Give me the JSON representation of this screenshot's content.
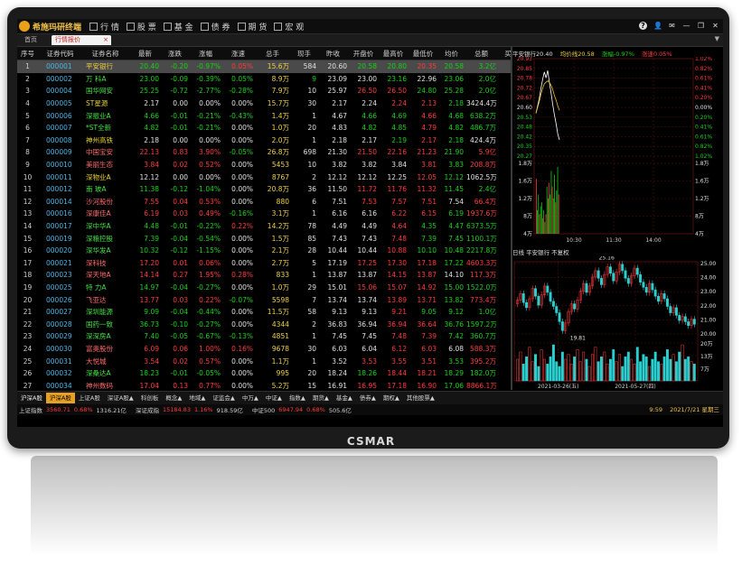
{
  "app": {
    "logo_text": "希施玛研终端",
    "menu": [
      {
        "label": "行 情",
        "icon": "quotes-icon"
      },
      {
        "label": "股 票",
        "icon": "stock-icon"
      },
      {
        "label": "基 金",
        "icon": "fund-icon"
      },
      {
        "label": "债 券",
        "icon": "bond-icon"
      },
      {
        "label": "期 货",
        "icon": "futures-icon"
      },
      {
        "label": "宏 观",
        "icon": "macro-icon"
      }
    ],
    "window_controls": {
      "help": "?",
      "user": "👤",
      "msg": "✉",
      "minimize": "—",
      "restore": "❐",
      "close": "✕"
    }
  },
  "tabs": {
    "home": "首页",
    "active": "行情报价",
    "close": "×",
    "more": "▼"
  },
  "table": {
    "headers": [
      "序号",
      "证券代码",
      "证券名称",
      "最新",
      "涨跌",
      "涨幅",
      "涨速",
      "总手",
      "现手",
      "昨收",
      "开盘价",
      "最高价",
      "最低价",
      "均价",
      "总额",
      "买"
    ],
    "rows": [
      [
        "1",
        "000001",
        "平安银行",
        "20.40",
        "-0.20",
        "-0.97%",
        "0.05%",
        "15.6万",
        "584",
        "20.60",
        "20.58",
        "20.80",
        "20.35",
        "20.58",
        "3.2亿",
        ""
      ],
      [
        "2",
        "000002",
        "万 科A",
        "23.00",
        "-0.09",
        "-0.39%",
        "0.05%",
        "8.9万",
        "9",
        "23.09",
        "23.00",
        "23.16",
        "22.96",
        "23.06",
        "2.0亿",
        ""
      ],
      [
        "3",
        "000004",
        "国华网安",
        "25.25",
        "-0.72",
        "-2.77%",
        "-0.28%",
        "7.9万",
        "10",
        "25.97",
        "26.50",
        "26.50",
        "24.80",
        "25.28",
        "2.0亿",
        ""
      ],
      [
        "4",
        "000005",
        "ST星源",
        "2.17",
        "0.00",
        "0.00%",
        "0.00%",
        "15.7万",
        "30",
        "2.17",
        "2.24",
        "2.24",
        "2.13",
        "2.18",
        "3424.4万",
        ""
      ],
      [
        "5",
        "000006",
        "深振业A",
        "4.66",
        "-0.01",
        "-0.21%",
        "-0.43%",
        "1.4万",
        "1",
        "4.67",
        "4.66",
        "4.69",
        "4.66",
        "4.68",
        "638.2万",
        ""
      ],
      [
        "6",
        "000007",
        "*ST全新",
        "4.82",
        "-0.01",
        "-0.21%",
        "0.00%",
        "1.0万",
        "20",
        "4.83",
        "4.82",
        "4.85",
        "4.79",
        "4.82",
        "486.7万",
        ""
      ],
      [
        "7",
        "000008",
        "神州高铁",
        "2.18",
        "0.00",
        "0.00%",
        "0.00%",
        "2.0万",
        "1",
        "2.18",
        "2.17",
        "2.19",
        "2.17",
        "2.18",
        "424.4万",
        ""
      ],
      [
        "8",
        "000009",
        "中国宝安",
        "22.13",
        "0.83",
        "3.90%",
        "-0.05%",
        "26.8万",
        "698",
        "21.30",
        "21.50",
        "22.16",
        "21.23",
        "21.90",
        "5.9亿",
        ""
      ],
      [
        "9",
        "000010",
        "美丽生态",
        "3.84",
        "0.02",
        "0.52%",
        "0.00%",
        "5453",
        "10",
        "3.82",
        "3.82",
        "3.84",
        "3.81",
        "3.83",
        "208.8万",
        ""
      ],
      [
        "10",
        "000011",
        "深物业A",
        "12.12",
        "0.00",
        "0.00%",
        "0.00%",
        "8767",
        "2",
        "12.12",
        "12.12",
        "12.25",
        "12.05",
        "12.12",
        "1062.5万",
        ""
      ],
      [
        "11",
        "000012",
        "南 玻A",
        "11.38",
        "-0.12",
        "-1.04%",
        "0.00%",
        "20.8万",
        "36",
        "11.50",
        "11.72",
        "11.76",
        "11.32",
        "11.45",
        "2.4亿",
        ""
      ],
      [
        "12",
        "000014",
        "沙河股份",
        "7.55",
        "0.04",
        "0.53%",
        "0.00%",
        "880",
        "6",
        "7.51",
        "7.53",
        "7.57",
        "7.51",
        "7.54",
        "66.4万",
        ""
      ],
      [
        "13",
        "000016",
        "深康佳A",
        "6.19",
        "0.03",
        "0.49%",
        "-0.16%",
        "3.1万",
        "1",
        "6.16",
        "6.16",
        "6.22",
        "6.15",
        "6.19",
        "1937.6万",
        ""
      ],
      [
        "14",
        "000017",
        "深中华A",
        "4.48",
        "-0.01",
        "-0.22%",
        "0.22%",
        "14.2万",
        "78",
        "4.49",
        "4.49",
        "4.64",
        "4.35",
        "4.47",
        "6373.5万",
        ""
      ],
      [
        "15",
        "000019",
        "深粮控股",
        "7.39",
        "-0.04",
        "-0.54%",
        "0.00%",
        "1.5万",
        "85",
        "7.43",
        "7.43",
        "7.48",
        "7.39",
        "7.45",
        "1100.1万",
        ""
      ],
      [
        "16",
        "000020",
        "深华发A",
        "10.32",
        "-0.12",
        "-1.15%",
        "0.00%",
        "2.1万",
        "28",
        "10.44",
        "10.44",
        "10.88",
        "10.10",
        "10.48",
        "2217.8万",
        ""
      ],
      [
        "17",
        "000021",
        "深科技",
        "17.20",
        "0.01",
        "0.06%",
        "0.00%",
        "2.7万",
        "5",
        "17.19",
        "17.25",
        "17.30",
        "17.18",
        "17.22",
        "4603.3万",
        ""
      ],
      [
        "18",
        "000023",
        "深天地A",
        "14.14",
        "0.27",
        "1.95%",
        "0.28%",
        "833",
        "1",
        "13.87",
        "13.87",
        "14.15",
        "13.87",
        "14.10",
        "117.3万",
        ""
      ],
      [
        "19",
        "000025",
        "特 力A",
        "14.97",
        "-0.04",
        "-0.27%",
        "0.00%",
        "1.0万",
        "29",
        "15.01",
        "15.06",
        "15.07",
        "14.92",
        "15.00",
        "1522.0万",
        ""
      ],
      [
        "20",
        "000026",
        "飞亚达",
        "13.77",
        "0.03",
        "0.22%",
        "-0.07%",
        "5598",
        "7",
        "13.74",
        "13.74",
        "13.89",
        "13.71",
        "13.82",
        "773.4万",
        ""
      ],
      [
        "21",
        "000027",
        "深圳能源",
        "9.09",
        "-0.04",
        "-0.44%",
        "0.00%",
        "11.5万",
        "58",
        "9.13",
        "9.13",
        "9.21",
        "9.05",
        "9.12",
        "1.0亿",
        ""
      ],
      [
        "22",
        "000028",
        "国药一致",
        "36.73",
        "-0.10",
        "-0.27%",
        "0.00%",
        "4344",
        "2",
        "36.83",
        "36.94",
        "36.94",
        "36.64",
        "36.76",
        "1597.2万",
        ""
      ],
      [
        "23",
        "000029",
        "深深房A",
        "7.40",
        "-0.05",
        "-0.67%",
        "-0.13%",
        "4851",
        "1",
        "7.45",
        "7.45",
        "7.48",
        "7.39",
        "7.42",
        "360.7万",
        ""
      ],
      [
        "24",
        "000030",
        "富奥股份",
        "6.09",
        "0.06",
        "1.00%",
        "0.16%",
        "9678",
        "30",
        "6.03",
        "6.04",
        "6.12",
        "6.03",
        "6.08",
        "588.3万",
        ""
      ],
      [
        "25",
        "000031",
        "大悦城",
        "3.54",
        "0.02",
        "0.57%",
        "0.00%",
        "1.1万",
        "1",
        "3.52",
        "3.53",
        "3.55",
        "3.51",
        "3.53",
        "395.2万",
        ""
      ],
      [
        "26",
        "000032",
        "深桑达A",
        "18.23",
        "-0.01",
        "-0.05%",
        "0.00%",
        "995",
        "20",
        "18.24",
        "18.26",
        "18.44",
        "18.21",
        "18.29",
        "182.0万",
        ""
      ],
      [
        "27",
        "000034",
        "神州数码",
        "17.04",
        "0.13",
        "0.77%",
        "0.00%",
        "5.2万",
        "15",
        "16.91",
        "16.95",
        "17.18",
        "16.90",
        "17.06",
        "8866.1万",
        ""
      ]
    ],
    "row_colors": [
      [
        "dn",
        "dn",
        "dn",
        "up",
        "yl",
        "fl",
        "fl",
        "dn",
        "dn",
        "up",
        "dn",
        "dn",
        "dn",
        "yl"
      ],
      [
        "dn",
        "dn",
        "dn",
        "dn",
        "yl",
        "dn",
        "fl",
        "fl",
        "dn",
        "fl",
        "dn",
        "dn",
        "dn",
        "yl"
      ],
      [
        "dn",
        "dn",
        "dn",
        "dn",
        "yl",
        "fl",
        "fl",
        "up",
        "up",
        "dn",
        "dn",
        "dn",
        "dn",
        "yl"
      ],
      [
        "fl",
        "fl",
        "fl",
        "fl",
        "yl",
        "fl",
        "fl",
        "fl",
        "up",
        "up",
        "dn",
        "fl",
        "fl",
        "yl"
      ],
      [
        "dn",
        "dn",
        "dn",
        "dn",
        "yl",
        "fl",
        "fl",
        "dn",
        "dn",
        "up",
        "dn",
        "dn",
        "dn",
        "yl"
      ],
      [
        "dn",
        "dn",
        "dn",
        "fl",
        "yl",
        "fl",
        "fl",
        "dn",
        "dn",
        "up",
        "dn",
        "dn",
        "dn",
        "yl"
      ],
      [
        "fl",
        "fl",
        "fl",
        "fl",
        "yl",
        "fl",
        "fl",
        "fl",
        "dn",
        "up",
        "dn",
        "fl",
        "fl",
        "yl"
      ],
      [
        "up",
        "up",
        "up",
        "dn",
        "yl",
        "fl",
        "fl",
        "up",
        "up",
        "up",
        "dn",
        "up",
        "up",
        "yl"
      ],
      [
        "up",
        "up",
        "up",
        "fl",
        "yl",
        "fl",
        "fl",
        "fl",
        "fl",
        "up",
        "dn",
        "up",
        "up",
        "yl"
      ],
      [
        "fl",
        "fl",
        "fl",
        "fl",
        "yl",
        "fl",
        "fl",
        "fl",
        "fl",
        "up",
        "dn",
        "fl",
        "fl",
        "yl"
      ],
      [
        "dn",
        "dn",
        "dn",
        "fl",
        "yl",
        "fl",
        "fl",
        "up",
        "up",
        "up",
        "dn",
        "dn",
        "dn",
        "yl"
      ],
      [
        "up",
        "up",
        "up",
        "fl",
        "yl",
        "fl",
        "fl",
        "up",
        "up",
        "up",
        "fl",
        "up",
        "up",
        "yl"
      ],
      [
        "up",
        "up",
        "up",
        "dn",
        "yl",
        "fl",
        "fl",
        "fl",
        "up",
        "up",
        "dn",
        "up",
        "up",
        "yl"
      ],
      [
        "dn",
        "dn",
        "dn",
        "up",
        "yl",
        "fl",
        "fl",
        "fl",
        "up",
        "dn",
        "dn",
        "dn",
        "dn",
        "yl"
      ],
      [
        "dn",
        "dn",
        "dn",
        "fl",
        "yl",
        "fl",
        "fl",
        "fl",
        "up",
        "dn",
        "dn",
        "dn",
        "dn",
        "yl"
      ],
      [
        "dn",
        "dn",
        "dn",
        "fl",
        "yl",
        "fl",
        "fl",
        "fl",
        "up",
        "dn",
        "dn",
        "dn",
        "dn",
        "yl"
      ],
      [
        "up",
        "up",
        "up",
        "fl",
        "yl",
        "fl",
        "fl",
        "up",
        "up",
        "up",
        "dn",
        "up",
        "up",
        "yl"
      ],
      [
        "up",
        "up",
        "up",
        "up",
        "yl",
        "fl",
        "fl",
        "fl",
        "up",
        "up",
        "fl",
        "up",
        "up",
        "yl"
      ],
      [
        "dn",
        "dn",
        "dn",
        "fl",
        "yl",
        "fl",
        "fl",
        "up",
        "up",
        "up",
        "dn",
        "dn",
        "dn",
        "yl"
      ],
      [
        "up",
        "up",
        "up",
        "dn",
        "yl",
        "fl",
        "fl",
        "fl",
        "up",
        "up",
        "dn",
        "up",
        "up",
        "yl"
      ],
      [
        "dn",
        "dn",
        "dn",
        "fl",
        "yl",
        "fl",
        "fl",
        "fl",
        "up",
        "dn",
        "dn",
        "dn",
        "dn",
        "yl"
      ],
      [
        "dn",
        "dn",
        "dn",
        "fl",
        "yl",
        "fl",
        "fl",
        "fl",
        "up",
        "up",
        "dn",
        "dn",
        "dn",
        "yl"
      ],
      [
        "dn",
        "dn",
        "dn",
        "dn",
        "yl",
        "fl",
        "fl",
        "fl",
        "up",
        "up",
        "dn",
        "dn",
        "dn",
        "yl"
      ],
      [
        "up",
        "up",
        "up",
        "up",
        "yl",
        "fl",
        "fl",
        "fl",
        "up",
        "up",
        "fl",
        "up",
        "up",
        "yl"
      ],
      [
        "up",
        "up",
        "up",
        "fl",
        "yl",
        "fl",
        "fl",
        "up",
        "up",
        "up",
        "dn",
        "up",
        "up",
        "yl"
      ],
      [
        "dn",
        "dn",
        "dn",
        "fl",
        "yl",
        "fl",
        "fl",
        "dn",
        "up",
        "up",
        "dn",
        "dn",
        "dn",
        "yl"
      ],
      [
        "up",
        "up",
        "up",
        "fl",
        "yl",
        "fl",
        "fl",
        "up",
        "up",
        "up",
        "dn",
        "up",
        "up",
        "yl"
      ]
    ]
  },
  "intraday": {
    "name": "平安银行20.40",
    "avg_label": "均价线20.58",
    "chg_label": "涨幅-0.97%",
    "speed_label": "涨速0.05%",
    "left_ticks": [
      "20.93",
      "20.85",
      "20.78",
      "20.72",
      "20.67",
      "20.60",
      "20.53",
      "20.48",
      "20.42",
      "20.35",
      "20.27"
    ],
    "right_ticks": [
      "1.02%",
      "0.82%",
      "0.61%",
      "0.41%",
      "0.20%",
      "0.00%",
      "0.20%",
      "0.41%",
      "0.61%",
      "0.82%",
      "1.02%"
    ],
    "vol_left": [
      "1.8万",
      "1.6万",
      "1.2万",
      "8万",
      "4万"
    ],
    "vol_right": [
      "1.8万",
      "1.6万",
      "1.2万",
      "8万",
      "4万"
    ],
    "time_ticks": [
      "10:30",
      "11:30",
      "14:00"
    ],
    "prev_close": 20.6,
    "price_min": 20.27,
    "price_max": 20.93,
    "price_series": [
      20.56,
      20.61,
      20.66,
      20.73,
      20.79,
      20.84,
      20.8,
      20.85,
      20.77,
      20.7,
      20.62,
      20.55,
      20.49,
      20.42,
      20.38
    ],
    "avg_series": [
      20.56,
      20.6,
      20.64,
      20.69,
      20.73,
      20.76,
      20.77,
      20.78,
      20.77,
      20.75,
      20.72,
      20.68,
      20.65,
      20.61,
      20.58
    ],
    "vol_series": [
      14,
      6,
      10,
      5,
      7,
      8,
      4,
      6,
      3,
      5,
      12,
      9,
      13,
      10,
      16,
      12,
      9,
      15,
      8,
      11,
      17,
      10
    ]
  },
  "kline": {
    "title": "日线 平安银行 不复权",
    "price_ticks": [
      "25.00",
      "24.00",
      "23.00",
      "22.00",
      "21.00",
      "20.00"
    ],
    "vol_ticks": [
      "20万",
      "13万",
      "7万"
    ],
    "date_ticks": [
      "2021-03-26(五)",
      "2021-05-27(四)"
    ],
    "high_label": "25.16",
    "low_label": "19.81",
    "price_min": 19.5,
    "price_max": 25.3,
    "closes": [
      22.3,
      22.8,
      22.1,
      21.7,
      22.4,
      23.2,
      22.6,
      21.9,
      22.7,
      23.4,
      22.9,
      22.2,
      21.8,
      21.3,
      20.6,
      19.9,
      20.5,
      21.4,
      22.0,
      21.6,
      22.3,
      23.0,
      23.6,
      22.9,
      23.4,
      24.1,
      24.6,
      24.0,
      23.5,
      24.3,
      24.9,
      24.4,
      23.8,
      24.5,
      25.1,
      24.6,
      24.0,
      23.6,
      24.2,
      24.8,
      24.3,
      23.7,
      23.3,
      22.9,
      23.6,
      23.1,
      22.6,
      22.2,
      22.8,
      22.4,
      21.8,
      21.3,
      21.7,
      21.1,
      20.7,
      21.0,
      20.6,
      20.3,
      20.8,
      20.4
    ],
    "volumes": [
      9,
      12,
      7,
      10,
      14,
      8,
      11,
      6,
      13,
      9,
      7,
      10,
      15,
      8,
      6,
      12,
      9,
      11,
      7,
      10,
      13,
      8,
      12,
      9,
      6,
      11,
      14,
      8,
      10,
      12,
      7,
      9,
      13,
      8,
      11,
      6,
      10,
      12,
      9,
      7,
      14,
      8,
      11,
      10,
      6,
      9,
      12,
      8,
      7,
      10,
      13,
      9,
      11,
      8,
      12,
      15,
      9,
      10,
      8,
      7
    ]
  },
  "sheets": [
    "沪深A股",
    "沪深A股",
    "上证A股",
    "深证A股▲",
    "科创板",
    "概念▲",
    "地域▲",
    "证监会▲",
    "中万▲",
    "中证▲",
    "指数▲",
    "期货▲",
    "基金▲",
    "债券▲",
    "期权▲",
    "其他股票▲"
  ],
  "status": {
    "sh_label": "上证指数",
    "sh_value": "3560.71",
    "sh_change": "0.68%",
    "sh_volume": "1316.21亿",
    "sz_label": "深证成指",
    "sz_value": "15184.83",
    "sz_change": "1.16%",
    "sz_volume": "918.59亿",
    "zz_label": "中证500",
    "zz_value": "6947.94",
    "zz_change": "0.68%",
    "zz_volume": "505.6亿",
    "time": "9:59",
    "date": "2021/7/21 星期三"
  },
  "brand": "CSMAR",
  "colors": {
    "up": "#ff3b3b",
    "down": "#19d119",
    "flat": "#e0e0e0",
    "accent": "#e8a020",
    "code": "#4ab6e8",
    "name": "#e8d030"
  }
}
